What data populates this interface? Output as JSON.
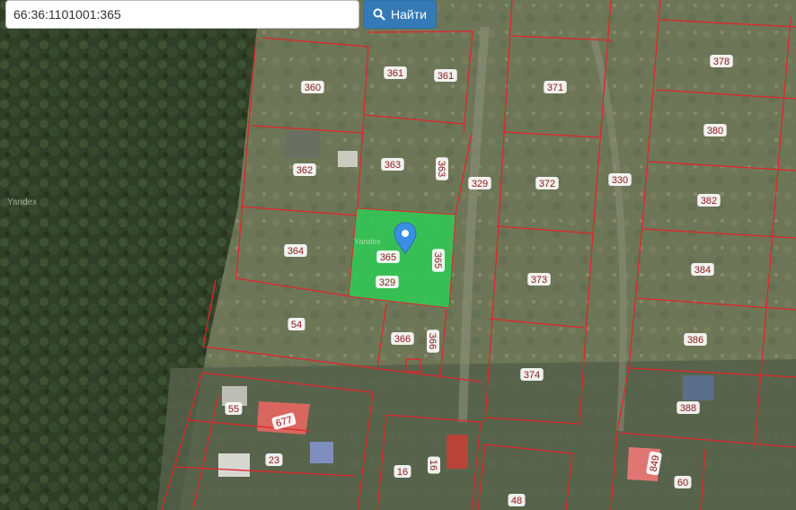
{
  "search": {
    "value": "66:36:1101001:365",
    "button_label": "Найти",
    "button_icon": "search-icon"
  },
  "map": {
    "provider_watermark": "Yandex",
    "provider_watermark_small": "Yandex",
    "selected_parcel": "365",
    "highlight_color": "#2ecc55",
    "boundary_color": "#e0262b",
    "marker_color": "#3b8fe0"
  },
  "parcel_labels": [
    "360",
    "361",
    "361",
    "371",
    "378",
    "362",
    "363",
    "363",
    "329",
    "372",
    "330",
    "380",
    "364",
    "365",
    "365",
    "329",
    "373",
    "382",
    "384",
    "54",
    "366",
    "366",
    "374",
    "386",
    "55",
    "677",
    "23",
    "16",
    "16",
    "48",
    "849",
    "60",
    "388"
  ]
}
